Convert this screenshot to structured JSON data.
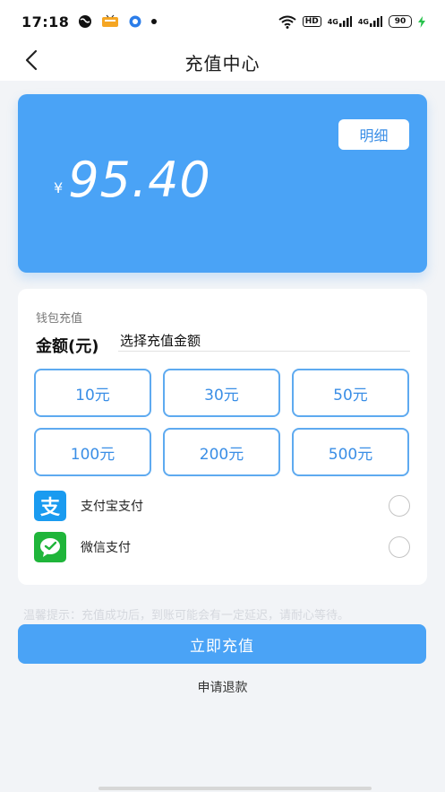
{
  "status_bar": {
    "time": "17:18",
    "icons_left": [
      "globe-icon",
      "app-icon",
      "chat-bubble-icon",
      "dot-icon"
    ],
    "network": [
      "4G",
      "4G"
    ],
    "hd_label": "HD",
    "battery": "90"
  },
  "nav": {
    "title": "充值中心",
    "back_icon": "chevron-left-icon"
  },
  "balance_card": {
    "currency": "¥",
    "amount": "95.40",
    "detail_label": "明细"
  },
  "recharge": {
    "section_label": "钱包充值",
    "amount_label": "金额(元)",
    "amount_placeholder": "选择充值金额",
    "options": [
      "10元",
      "30元",
      "50元",
      "100元",
      "200元",
      "500元"
    ]
  },
  "payment": {
    "methods": [
      {
        "label": "支付宝支付",
        "icon": "alipay-icon",
        "icon_glyph": "支"
      },
      {
        "label": "微信支付",
        "icon": "wechat-icon"
      }
    ]
  },
  "tip": "温馨提示：充值成功后，到账可能会有一定延迟，请耐心等待。",
  "submit_label": "立即充值",
  "refund_label": "申请退款",
  "colors": {
    "accent": "#4aa3f6",
    "option_border": "#5eaaf0",
    "option_text": "#3a8ee6",
    "alipay": "#1a9bf0",
    "wechat": "#1fb53a",
    "page_bg": "#f2f4f7"
  }
}
